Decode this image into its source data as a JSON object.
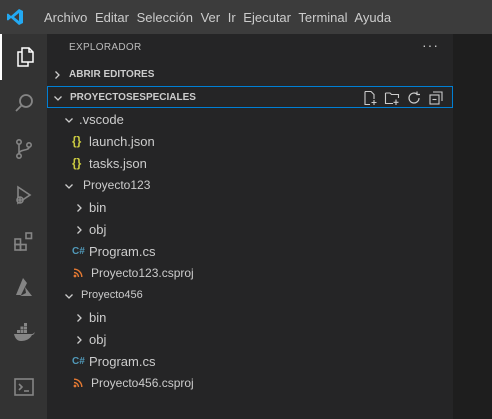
{
  "menu": [
    "Archivo",
    "Editar",
    "Selección",
    "Ver",
    "Ir",
    "Ejecutar",
    "Terminal",
    "Ayuda"
  ],
  "explorer": {
    "title": "EXPLORADOR",
    "more": "···",
    "open_editors": "ABRIR EDITORES",
    "project": "PROYECTOSESPECIALES"
  },
  "tree": [
    {
      "label": ".vscode",
      "type": "folder",
      "expanded": true,
      "level": 1
    },
    {
      "label": "launch.json",
      "type": "json",
      "level": 2
    },
    {
      "label": "tasks.json",
      "type": "json",
      "level": 2
    },
    {
      "label": "Proyecto123",
      "type": "folder",
      "expanded": true,
      "level": 1
    },
    {
      "label": "bin",
      "type": "folder",
      "expanded": false,
      "level": 2
    },
    {
      "label": "obj",
      "type": "folder",
      "expanded": false,
      "level": 2
    },
    {
      "label": "Program.cs",
      "type": "cs",
      "level": 2
    },
    {
      "label": "Proyecto123.csproj",
      "type": "csproj",
      "level": 2
    },
    {
      "label": "Proyecto456",
      "type": "folder",
      "expanded": true,
      "level": 1
    },
    {
      "label": "bin",
      "type": "folder",
      "expanded": false,
      "level": 2
    },
    {
      "label": "obj",
      "type": "folder",
      "expanded": false,
      "level": 2
    },
    {
      "label": "Program.cs",
      "type": "cs",
      "level": 2
    },
    {
      "label": "Proyecto456.csproj",
      "type": "csproj",
      "level": 2
    }
  ],
  "icons": {
    "json": "{}",
    "cs": "C#"
  },
  "colors": {
    "accent": "#007fd4",
    "json": "#cbcb41",
    "cs": "#519aba",
    "csproj": "#e37933"
  }
}
